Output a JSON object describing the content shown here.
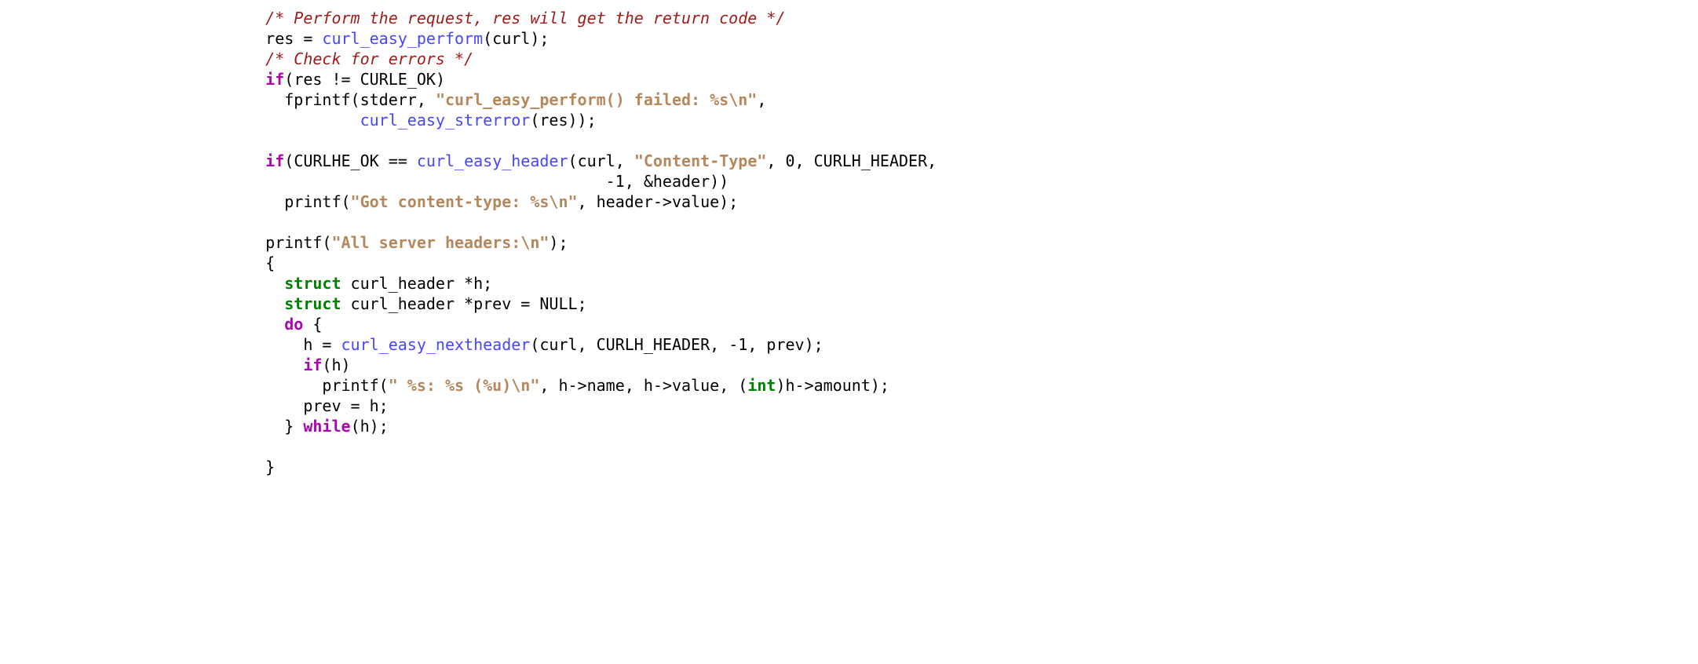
{
  "code": {
    "indent4": "    ",
    "indent6": "      ",
    "indent8": "        ",
    "indent10": "          ",
    "indent14": "              ",
    "indent40": "                                        ",
    "comment_perform": "/* Perform the request, res will get the return code */",
    "comment_check": "/* Check for errors */",
    "tok_res": "res",
    "tok_eq_sp": " = ",
    "fn_perform": "curl_easy_perform",
    "tok_lparen": "(",
    "tok_rparen": ")",
    "tok_semi": ";",
    "tok_curl": "curl",
    "kw_if": "if",
    "tok_neq": " != ",
    "tok_curle_ok": "CURLE_OK",
    "tok_fprintf": "fprintf",
    "tok_stderr": "stderr",
    "tok_comma_sp": ", ",
    "str_perform_failed": "\"curl_easy_perform() failed: %s\\n\"",
    "tok_comma": ",",
    "fn_strerror": "curl_easy_strerror",
    "tok_rparen2": "))",
    "tok_curlhe_ok": "CURLHE_OK",
    "tok_eqeq": " == ",
    "fn_header": "curl_easy_header",
    "str_content_type": "\"Content-Type\"",
    "tok_zero": "0",
    "tok_curlh_header": "CURLH_HEADER",
    "tok_neg1": "-1",
    "tok_amp_header": "&header",
    "tok_printf": "printf",
    "str_got_ct": "\"Got content-type: %s\\n\"",
    "tok_header_value": "header->value",
    "str_all_headers": "\"All server headers:\\n\"",
    "tok_lbrace": "{",
    "tok_rbrace": "}",
    "kw_struct": "struct",
    "tok_curl_header": " curl_header ",
    "tok_star_h": "*h",
    "tok_star_prev_null": "*prev = NULL",
    "kw_do": "do",
    "tok_sp_lbrace": " {",
    "tok_h_eq": "h = ",
    "fn_nextheader": "curl_easy_nextheader",
    "tok_prev": "prev",
    "tok_h": "h",
    "str_line": "\" %s: %s (%u)\\n\"",
    "tok_h_name": "h->name",
    "tok_h_value": "h->value",
    "tok_lparen_cast": "(",
    "kw_int": "int",
    "tok_rparen_cast": ")",
    "tok_h_amount": "h->amount",
    "tok_prev_eq_h": "prev = h",
    "tok_rbrace_sp": "} ",
    "kw_while": "while"
  }
}
